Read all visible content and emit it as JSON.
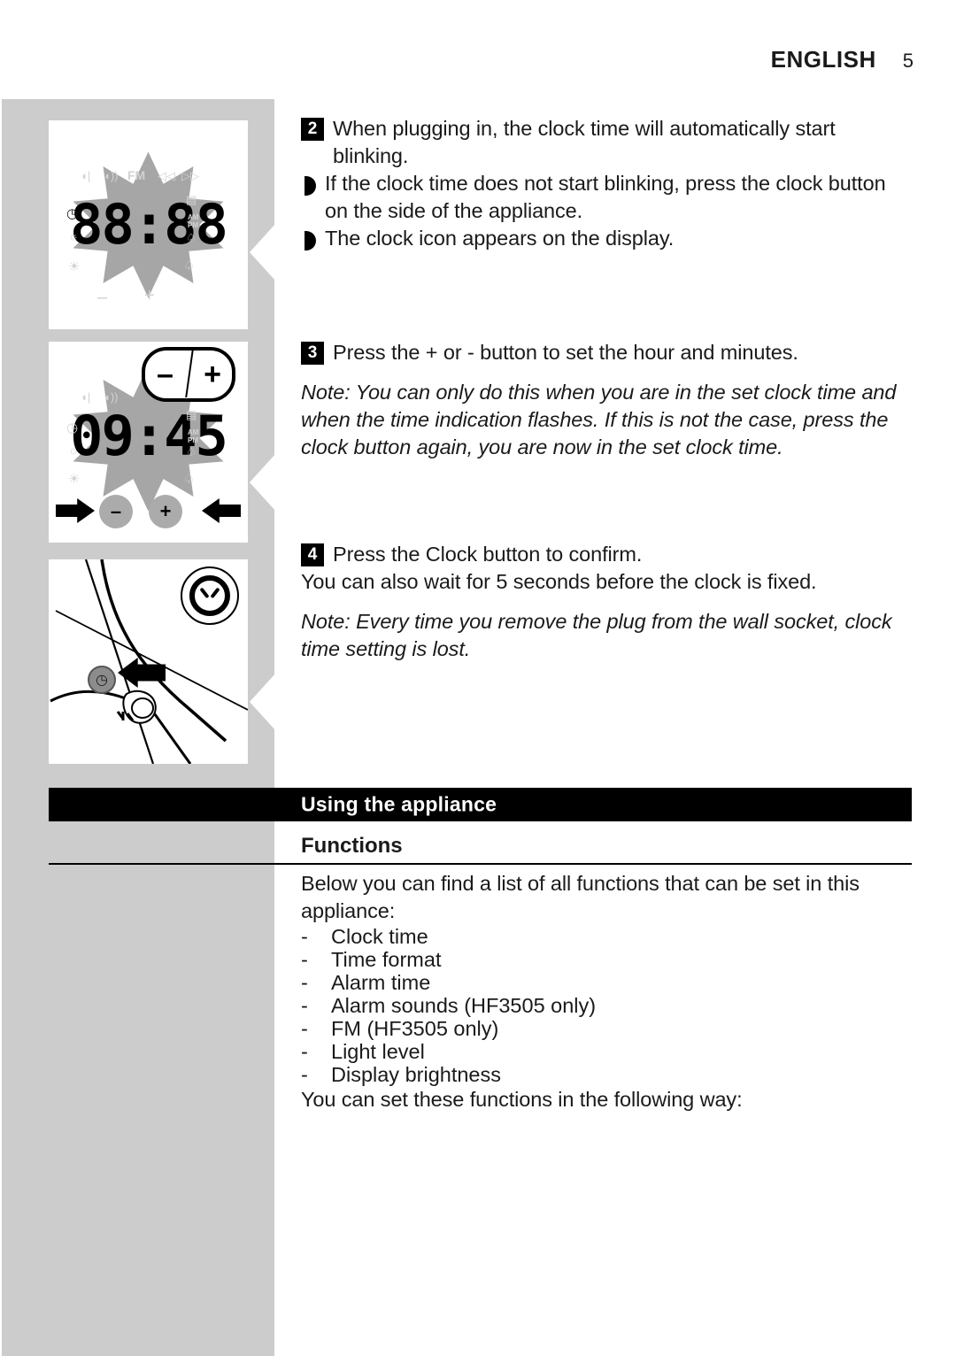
{
  "header": {
    "language": "ENGLISH",
    "page_number": "5"
  },
  "steps": [
    {
      "number": "2",
      "text": "When plugging in, the clock time will automatically start blinking.",
      "bullets": [
        "If the clock time does not start blinking, press the clock button on the side of the appliance.",
        "The clock icon appears on the display."
      ]
    },
    {
      "number": "3",
      "text": "Press the + or - button to set the hour and minutes.",
      "note": "Note: You can only do this when you are in the set clock time and when the time indication flashes. If this is not the case, press the clock button again, you are now in the set clock time."
    },
    {
      "number": "4",
      "text": "Press the Clock button to confirm.",
      "subtext": "You can also wait for 5 seconds before the clock is fixed.",
      "note": "Note: Every time you remove the plug from the wall socket, clock time setting is lost."
    }
  ],
  "section": {
    "banner_title": "Using the appliance",
    "subheading": "Functions",
    "intro": "Below you can find a list of all functions that can be set in this appliance:",
    "dash": "-",
    "functions": [
      "Clock time",
      "Time format",
      "Alarm time",
      "Alarm sounds (HF3505 only)",
      "FM (HF3505 only)",
      "Light level",
      "Display brightness"
    ],
    "outro": "You can set these functions in the following way:"
  },
  "illustrations": {
    "display_all_segments": {
      "digits": "88:88",
      "icons": {
        "volume_down": "◖",
        "volume_up": "◖))",
        "fm": "FM",
        "rewind": "◁◁",
        "forward": "▷▷",
        "clock": "◷",
        "brightness_low": "☼",
        "brightness_high": "☀",
        "radio": "📻",
        "ampm": "AM\nPM",
        "bell_small": "♩",
        "bell_large": "♩",
        "minus": "–",
        "plus": "+"
      }
    },
    "display_time_set": {
      "digits": "09:45",
      "pill_minus": "–",
      "pill_plus": "+",
      "button_minus": "–",
      "button_plus": "+"
    },
    "clock_button_side": {
      "emblem": "clock",
      "button": "◷"
    }
  },
  "colors": {
    "page_background": "#ffffff",
    "sidebar_gray": "#cccccc",
    "banner_black": "#000000",
    "burst_gray": "#a6a6a6",
    "icon_gray": "#d2d2d2",
    "button_gray": "#ababab"
  }
}
